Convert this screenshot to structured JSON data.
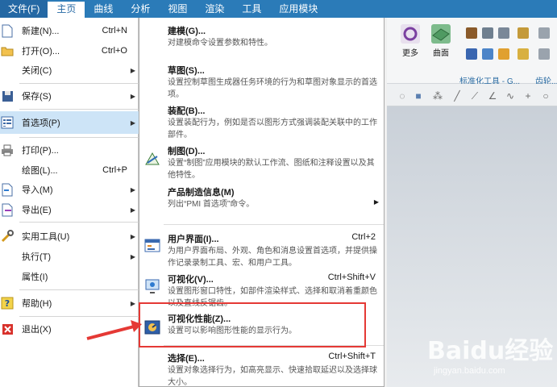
{
  "tabs": [
    {
      "label": "文件(F)"
    },
    {
      "label": "主页"
    },
    {
      "label": "曲线"
    },
    {
      "label": "分析"
    },
    {
      "label": "视图"
    },
    {
      "label": "渲染"
    },
    {
      "label": "工具"
    },
    {
      "label": "应用模块"
    }
  ],
  "left_menu": [
    {
      "label": "新建(N)...",
      "shortcut": "Ctrl+N",
      "icon": "new-file-icon"
    },
    {
      "label": "打开(O)...",
      "shortcut": "Ctrl+O",
      "icon": "open-folder-icon"
    },
    {
      "label": "关闭(C)",
      "shortcut": "",
      "icon": ""
    },
    {
      "label": "保存(S)",
      "shortcut": "",
      "icon": "save-icon"
    },
    {
      "label": "首选项(P)",
      "shortcut": "",
      "icon": "preferences-icon"
    },
    {
      "label": "打印(P)...",
      "shortcut": "",
      "icon": "print-icon"
    },
    {
      "label": "绘图(L)...",
      "shortcut": "Ctrl+P",
      "icon": ""
    },
    {
      "label": "导入(M)",
      "shortcut": "",
      "icon": "import-icon"
    },
    {
      "label": "导出(E)",
      "shortcut": "",
      "icon": "export-icon"
    },
    {
      "label": "实用工具(U)",
      "shortcut": "",
      "icon": "utilities-icon"
    },
    {
      "label": "执行(T)",
      "shortcut": "",
      "icon": ""
    },
    {
      "label": "属性(I)",
      "shortcut": "",
      "icon": ""
    },
    {
      "label": "帮助(H)",
      "shortcut": "",
      "icon": "help-icon"
    },
    {
      "label": "退出(X)",
      "shortcut": "",
      "icon": "exit-icon"
    }
  ],
  "submenu": [
    {
      "title": "建模(G)...",
      "shortcut": "",
      "desc": "对建模命令设置参数和特性。",
      "icon": ""
    },
    {
      "title": "草图(S)...",
      "shortcut": "",
      "desc": "设置控制草图生成器任务环境的行为和草图对象显示的首选项。",
      "icon": ""
    },
    {
      "title": "装配(B)...",
      "shortcut": "",
      "desc": "设置装配行为，例如是否以图形方式强调装配关联中的工作部件。",
      "icon": ""
    },
    {
      "title": "制图(D)...",
      "shortcut": "",
      "desc": "设置“制图”应用模块的默认工作流、图纸和注释设置以及其他特性。",
      "icon": "drafting-icon"
    },
    {
      "title": "产品制造信息(M)",
      "shortcut": "",
      "desc": "列出“PMI 首选项”命令。",
      "icon": ""
    },
    {
      "title": "用户界面(I)...",
      "shortcut": "Ctrl+2",
      "desc": "为用户界面布局、外观、角色和消息设置首选项，并提供操作记录录制工具、宏、和用户工具。",
      "icon": "user-interface-icon"
    },
    {
      "title": "可视化(V)...",
      "shortcut": "Ctrl+Shift+V",
      "desc": "设置图形窗口特性，如部件渲染样式、选择和取消着重颜色以及直线反锯齿。",
      "icon": "visualization-icon"
    },
    {
      "title": "可视化性能(Z)...",
      "shortcut": "",
      "desc": "设置可以影响图形性能的显示行为。",
      "icon": "visualization-performance-icon"
    },
    {
      "title": "选择(E)...",
      "shortcut": "Ctrl+Shift+T",
      "desc": "设置对象选择行为，如高亮显示、快速拾取延迟以及选择球大小。",
      "icon": ""
    }
  ],
  "ribbon": {
    "more_label": "更多",
    "surface_label": "曲面",
    "std_tools_label": "标准化工具 - G...",
    "gear_label": "齿轮..."
  },
  "watermark": {
    "logo": "Baidu经验",
    "url": "jingyan.baidu.com"
  },
  "colors": {
    "tab_bar": "#2b7bb8",
    "selection": "#cde4f7",
    "highlight": "#e53935"
  }
}
